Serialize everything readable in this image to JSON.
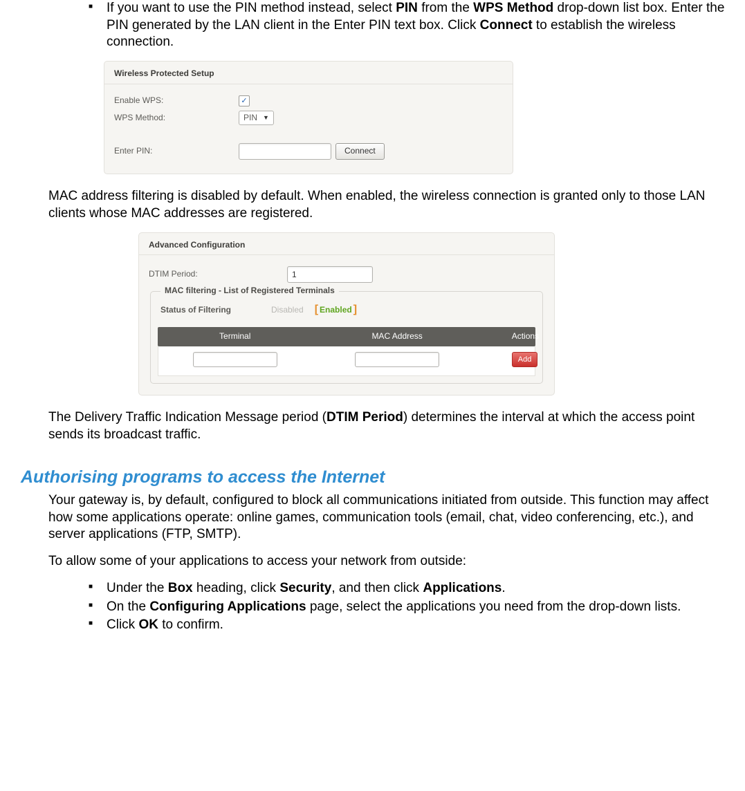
{
  "bullet_pin": {
    "prefix": "If you want to use the PIN method instead, select ",
    "b1": "PIN",
    "mid1": " from the ",
    "b2": "WPS Method",
    "mid2": " drop-down list box. Enter the PIN generated by the LAN client in the Enter PIN text box. Click ",
    "b3": "Connect",
    "suffix": " to establish the wireless connection."
  },
  "wps_panel": {
    "title": "Wireless Protected Setup",
    "enable_label": "Enable WPS:",
    "enable_checked": "✓",
    "method_label": "WPS Method:",
    "method_value": "PIN",
    "pin_label": "Enter PIN:",
    "connect_btn": "Connect"
  },
  "mac_para": "MAC address filtering is disabled by default. When enabled, the wireless connection is granted only to those LAN clients whose MAC addresses are registered.",
  "adv_panel": {
    "title": "Advanced Configuration",
    "dtim_label": "DTIM Period:",
    "dtim_value": "1",
    "fieldset_title": "MAC filtering - List of Registered Terminals",
    "status_label": "Status of Filtering",
    "disabled_text": "Disabled",
    "enabled_text": "Enabled",
    "col_terminal": "Terminal",
    "col_mac": "MAC Address",
    "col_actions": "Actions",
    "add_btn": "Add"
  },
  "dtim_para": {
    "p1": "The Delivery Traffic Indication Message period (",
    "b1": "DTIM Period",
    "p2": ") determines the interval at which the access point sends its broadcast traffic."
  },
  "section_heading": "Authorising programs to access the Internet",
  "gateway_para": "Your gateway is, by default, configured to block all communications initiated from outside. This function may affect how some applications operate: online games, communication tools (email, chat, video conferencing, etc.), and server applications (FTP, SMTP).",
  "allow_para": "To allow some of your applications to access your network from outside:",
  "auth_bullets": {
    "b1": {
      "t1": "Under the ",
      "b1": "Box",
      "t2": " heading, click ",
      "b2": "Security",
      "t3": ", and then click ",
      "b3": "Applications",
      "t4": "."
    },
    "b2": {
      "t1": "On the ",
      "b1": "Configuring Applications",
      "t2": " page, select the applications you need from the drop-down lists."
    },
    "b3": {
      "t1": "Click ",
      "b1": "OK",
      "t2": " to confirm."
    }
  }
}
